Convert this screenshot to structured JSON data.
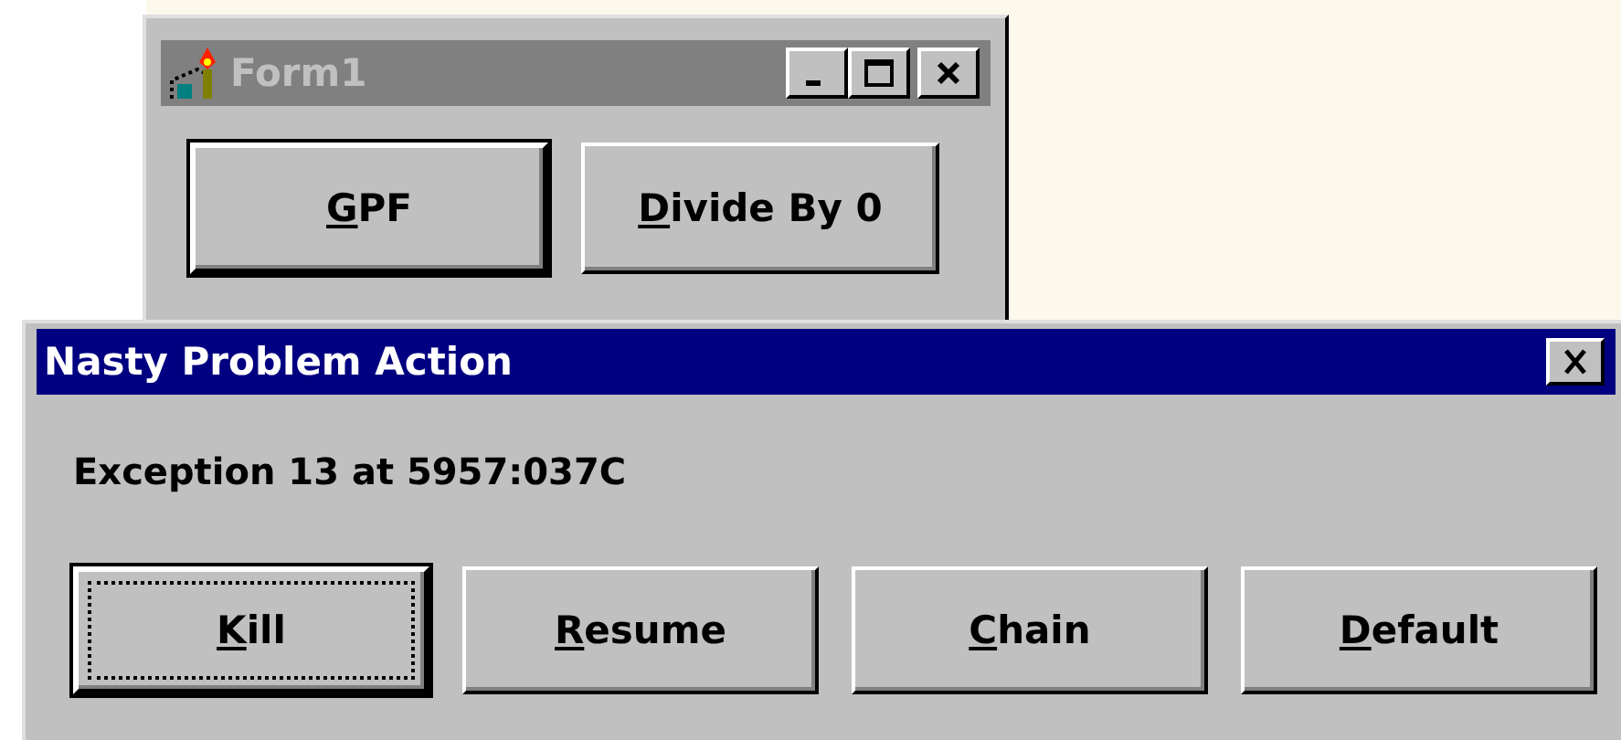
{
  "form_window": {
    "title": "Form1",
    "active": false,
    "buttons": [
      {
        "mnemonic": "G",
        "rest": "PF",
        "default": true
      },
      {
        "mnemonic": "D",
        "rest": "ivide By 0",
        "default": false
      }
    ]
  },
  "dialog": {
    "title": "Nasty Problem Action",
    "active": true,
    "message": "Exception 13 at 5957:037C",
    "buttons": [
      {
        "mnemonic": "K",
        "rest": "ill",
        "default": true,
        "focused": true
      },
      {
        "mnemonic": "R",
        "rest": "esume",
        "default": false,
        "focused": false
      },
      {
        "mnemonic": "C",
        "rest": "hain",
        "default": false,
        "focused": false
      },
      {
        "mnemonic": "D",
        "rest": "efault",
        "default": false,
        "focused": false
      }
    ]
  }
}
